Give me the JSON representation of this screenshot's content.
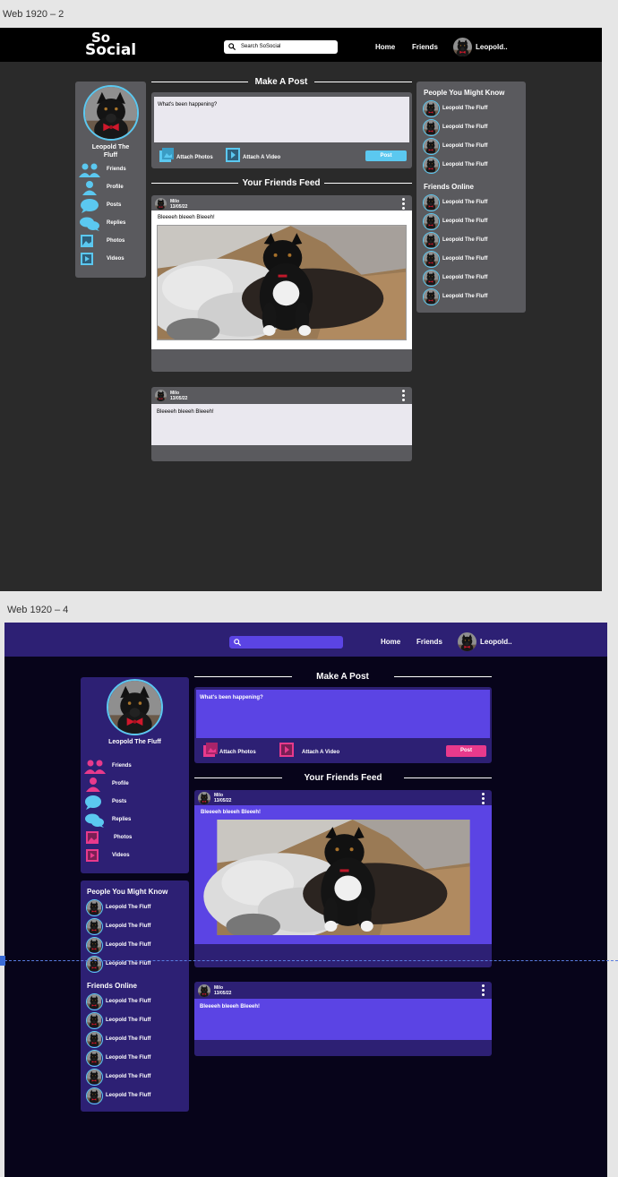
{
  "artboards": [
    {
      "label": "Web 1920 – 2"
    },
    {
      "label": "Web 1920 – 4"
    }
  ],
  "logo": {
    "line1": "So",
    "line2": "Social"
  },
  "search": {
    "placeholder": "Search SoSocial"
  },
  "nav": {
    "home": "Home",
    "friends": "Friends",
    "user": "Leopold.."
  },
  "profile": {
    "name_line1": "Leopold The",
    "name_line2": "Fluff",
    "name": "Leopold The Fluff"
  },
  "sidenav": [
    {
      "label": "Friends",
      "icon": "friends-icon"
    },
    {
      "label": "Profile",
      "icon": "profile-icon"
    },
    {
      "label": "Posts",
      "icon": "posts-icon"
    },
    {
      "label": "Replies",
      "icon": "replies-icon"
    },
    {
      "label": "Photos",
      "icon": "photos-icon"
    },
    {
      "label": "Videos",
      "icon": "videos-icon"
    }
  ],
  "make_post": {
    "title": "Make A Post",
    "placeholder": "What's been happening?",
    "attach_photos": "Attach Photos",
    "attach_video": "Attach A Video",
    "post_button": "Post"
  },
  "feed": {
    "title": "Your Friends Feed",
    "posts": [
      {
        "author": "Milo",
        "date": "13/05/22",
        "text": "Bleeeeh bleeeh Bleeeh!",
        "has_image": true
      },
      {
        "author": "Milo",
        "date": "13/05/22",
        "text": "Bleeeeh bleeeh Bleeeh!",
        "has_image": false
      }
    ]
  },
  "people_you_might_know": {
    "title": "People You Might Know",
    "people": [
      "Leopold The Fluff",
      "Leopold The Fluff",
      "Leopold The Fluff",
      "Leopold The Fluff"
    ]
  },
  "friends_online": {
    "title": "Friends Online",
    "people": [
      "Leopold The Fluff",
      "Leopold The Fluff",
      "Leopold The Fluff",
      "Leopold The Fluff",
      "Leopold The Fluff",
      "Leopold The Fluff"
    ]
  },
  "colors": {
    "theme1_bg": "#2a2a2a",
    "theme1_card": "#5a5a5e",
    "theme1_accent": "#5bc8f0",
    "theme2_bg": "#07041a",
    "theme2_card": "#2d2074",
    "theme2_purple": "#5b44e4",
    "theme2_accent": "#e83a8c"
  }
}
